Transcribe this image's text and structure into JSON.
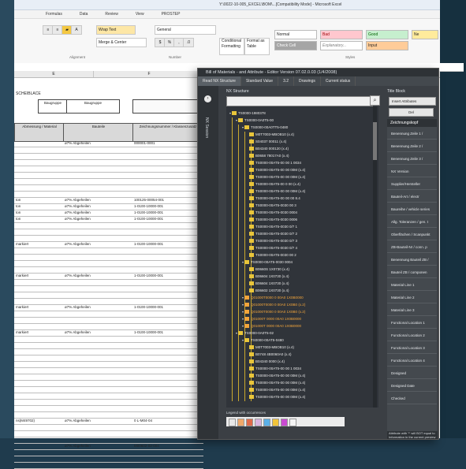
{
  "excel": {
    "title": "Y:\\0022-10-005_EXCEL\\BOM\\...[Compatibility Mode] - Microsoft Excel",
    "menu": [
      "Formulas",
      "Data",
      "Review",
      "View",
      "PROSTEP"
    ],
    "ribbon": {
      "wrap_text": "Wrap Text",
      "number_format": "General",
      "merge_center": "Merge & Center",
      "conditional_formatting": "Conditional Formatting",
      "format_as_table": "Format as Table",
      "styles": [
        "Normal",
        "Bad",
        "Good",
        "Ne",
        "Check Cell",
        "Explanatory...",
        "Input"
      ],
      "groups": [
        "Alignment",
        "Number",
        "Styles"
      ]
    },
    "columns": [
      "E",
      "F"
    ],
    "sheet_header": "SCHEIBLACE",
    "header_boxes": [
      "Baugruppe",
      "Baugruppe"
    ],
    "table_headers": [
      "Abmessung / Material",
      "Bauteile",
      "Zeichnungsnummer / Klassenzusatz"
    ],
    "rows": [
      {
        "a": "",
        "b": "ø7% Abgeheilen",
        "c": "000001-0001"
      },
      {
        "a": "",
        "b": "",
        "c": ""
      },
      {
        "a": "",
        "b": "",
        "c": ""
      },
      {
        "a": "",
        "b": "",
        "c": ""
      },
      {
        "a": "",
        "b": "",
        "c": ""
      },
      {
        "a": "",
        "b": "",
        "c": ""
      },
      {
        "a": "",
        "b": "",
        "c": ""
      },
      {
        "a": "",
        "b": "",
        "c": ""
      },
      {
        "a": "",
        "b": "",
        "c": ""
      },
      {
        "a": "ton",
        "b": "ø7% Abgeheilen",
        "c": "100125-00054-001"
      },
      {
        "a": "ton",
        "b": "ø7% Abgeheilen",
        "c": "1-0100-10000-001"
      },
      {
        "a": "ton",
        "b": "ø7% Abgeheilen",
        "c": "1-0100-10000-001"
      },
      {
        "a": "ton",
        "b": "ø7% Abgeheilen",
        "c": "1-0100-10000-001"
      },
      {
        "a": "",
        "b": "",
        "c": ""
      },
      {
        "a": "",
        "b": "",
        "c": ""
      },
      {
        "a": "",
        "b": "",
        "c": ""
      },
      {
        "a": "markiert",
        "b": "ø7% Abgeheilen",
        "c": "1-0100-10000-001"
      },
      {
        "a": "",
        "b": "",
        "c": ""
      },
      {
        "a": "",
        "b": "",
        "c": ""
      },
      {
        "a": "",
        "b": "",
        "c": ""
      },
      {
        "a": "",
        "b": "",
        "c": ""
      },
      {
        "a": "markiert",
        "b": "ø7% Abgeheilen",
        "c": "1-0100-10000-001"
      },
      {
        "a": "",
        "b": "",
        "c": ""
      },
      {
        "a": "",
        "b": "",
        "c": ""
      },
      {
        "a": "",
        "b": "",
        "c": ""
      },
      {
        "a": "",
        "b": "",
        "c": ""
      },
      {
        "a": "markiert",
        "b": "ø7% Abgeheilen",
        "c": "1-0100-10000-001"
      },
      {
        "a": "",
        "b": "",
        "c": ""
      },
      {
        "a": "",
        "b": "",
        "c": ""
      },
      {
        "a": "",
        "b": "",
        "c": ""
      },
      {
        "a": "markiert",
        "b": "ø7% Abgeheilen",
        "c": "1-0100-10000-001"
      },
      {
        "a": "",
        "b": "",
        "c": ""
      },
      {
        "a": "",
        "b": "",
        "c": ""
      },
      {
        "a": "",
        "b": "",
        "c": ""
      },
      {
        "a": "",
        "b": "",
        "c": ""
      },
      {
        "a": "",
        "b": "",
        "c": ""
      },
      {
        "a": "",
        "b": "",
        "c": ""
      },
      {
        "a": "",
        "b": "",
        "c": ""
      },
      {
        "a": "",
        "b": "",
        "c": ""
      },
      {
        "a": "",
        "b": "",
        "c": ""
      },
      {
        "a": "",
        "b": "",
        "c": ""
      },
      {
        "a": "",
        "b": "",
        "c": ""
      },
      {
        "a": "",
        "b": "",
        "c": ""
      },
      {
        "a": "",
        "b": "",
        "c": ""
      },
      {
        "a": "ns(M49702)",
        "b": "ø7% Abgeheilen",
        "c": "0 L-M04-04"
      },
      {
        "a": "",
        "b": "",
        "c": ""
      },
      {
        "a": "",
        "b": "",
        "c": ""
      },
      {
        "a": "",
        "b": "",
        "c": ""
      },
      {
        "a": "",
        "b": "ø7% Abgeheilen",
        "c": "M00602-02-004"
      },
      {
        "a": "",
        "b": "",
        "c": ""
      },
      {
        "a": "",
        "b": "",
        "c": ""
      },
      {
        "a": "",
        "b": "",
        "c": ""
      }
    ]
  },
  "dialog": {
    "title": "Bill of Materials - and Attribute - Editor Version 07.02.0.03 (1/4/2008)",
    "tabs": [
      "Read NX Structure",
      "Standard Value",
      "3.2",
      "Drawings",
      "Current status"
    ],
    "side_label": "NX Session",
    "tree_label": "NX Structure",
    "search_placeholder": "",
    "tree_nodes": [
      {
        "label": "TS0000-1980378",
        "depth": 0,
        "orange": false
      },
      {
        "label": "TS0000-0A0T5-00",
        "depth": 1,
        "orange": false
      },
      {
        "label": "TS0000-00A0TT5-0480",
        "depth": 2,
        "orange": false
      },
      {
        "label": "M0T7003-MBOB10 (x.4)",
        "depth": 3,
        "orange": false
      },
      {
        "label": "S04037 00011 (x.4)",
        "depth": 3,
        "orange": false
      },
      {
        "label": "B04340 000120 (x.4)",
        "depth": 3,
        "orange": false
      },
      {
        "label": "B0658 78017A0 (x.4)",
        "depth": 3,
        "orange": false
      },
      {
        "label": "TS0000-00AT5-00 00 1 0034",
        "depth": 3,
        "orange": false
      },
      {
        "label": "TS0000-00AT5-00 00 00M (x.4)",
        "depth": 3,
        "orange": false
      },
      {
        "label": "TS0000-00AT5-00 00 00M (x.4)",
        "depth": 3,
        "orange": false
      },
      {
        "label": "TS0000-00AT5-00 0 00 (x.4)",
        "depth": 3,
        "orange": false
      },
      {
        "label": "TS0000-00AT5-00 00 00M (x.4)",
        "depth": 3,
        "orange": false
      },
      {
        "label": "TS0000-00AT5-00 00 00 8.4",
        "depth": 3,
        "orange": false
      },
      {
        "label": "TS0000-00AT5-0030 00 3",
        "depth": 3,
        "orange": false
      },
      {
        "label": "TS0000-00AT5-0030 0004",
        "depth": 3,
        "orange": false
      },
      {
        "label": "TS0000-00AT5-0030 0006",
        "depth": 3,
        "orange": false
      },
      {
        "label": "TS0000-00AT5-0030 0/7 1",
        "depth": 3,
        "orange": false
      },
      {
        "label": "TS0000-00AT5-0030 0/7 2",
        "depth": 3,
        "orange": false
      },
      {
        "label": "TS0000-00AT5-0030 0/7 3",
        "depth": 3,
        "orange": false
      },
      {
        "label": "TS0000-00AT5-0030 0/7 4",
        "depth": 3,
        "orange": false
      },
      {
        "label": "TS0000-00AT5-0030 00 2",
        "depth": 3,
        "orange": false
      },
      {
        "label": "TS0000-00AT5-0030 0004",
        "depth": 2,
        "orange": false
      },
      {
        "label": "B0660S 1X0730 (x.4)",
        "depth": 3,
        "orange": false
      },
      {
        "label": "B06604 1X0730 (x.4)",
        "depth": 3,
        "orange": false
      },
      {
        "label": "B06604 1X0730 (x.4)",
        "depth": 3,
        "orange": false
      },
      {
        "label": "B06602 1X0730 (x.4)",
        "depth": 3,
        "orange": false
      },
      {
        "label": "Q01000T0000 0 00A0 1X0B0000",
        "depth": 2,
        "orange": true
      },
      {
        "label": "Q01000T0000 0 00A0 1X0B0 (x.2)",
        "depth": 2,
        "orange": true
      },
      {
        "label": "Q01000T0000 0 00A0 1X0B0 (x.2)",
        "depth": 2,
        "orange": true
      },
      {
        "label": "Q01000T 0000 00A0 1X0B0000",
        "depth": 2,
        "orange": true
      },
      {
        "label": "Q01000T 0000 00A0 1X0B0000",
        "depth": 2,
        "orange": true
      },
      {
        "label": "TS0000-0A0T5-02",
        "depth": 1,
        "orange": false
      },
      {
        "label": "TS0000-00AT5-0480",
        "depth": 2,
        "orange": false
      },
      {
        "label": "M0T7003-MBOB10 (x.4)",
        "depth": 3,
        "orange": false
      },
      {
        "label": "B0748 4B0060A0 (x.4)",
        "depth": 3,
        "orange": false
      },
      {
        "label": "B04340 0000 (x.4)",
        "depth": 3,
        "orange": false
      },
      {
        "label": "TS0000-00AT5-00 00 1 0034",
        "depth": 3,
        "orange": false
      },
      {
        "label": "TS0000-00AT5-00 00 00M (x.4)",
        "depth": 3,
        "orange": false
      },
      {
        "label": "TS0000-00AT5-00 00 00M (x.4)",
        "depth": 3,
        "orange": false
      },
      {
        "label": "TS0000-00AT5-00 00 00M (x.4)",
        "depth": 3,
        "orange": false
      },
      {
        "label": "TS0000-00AT5-00 00 00M (x.4)",
        "depth": 3,
        "orange": false
      }
    ],
    "legend_label": "Legend with occurrences",
    "legend_colors": [
      "#e8e8e8",
      "#f0a86a",
      "#e06a4a",
      "#d9b4e0",
      "#5bb0e8",
      "#f2c43a",
      "#c94ad1",
      "#f4f4f4"
    ],
    "props": {
      "label": "Title Block",
      "insert_button": "Insert Attributes",
      "second_button": "Del",
      "category": "Zeichnungskopf",
      "items": [
        "Benennung Zeile 1 /",
        "Benennung Zeile 2 /",
        "Benennung Zeile 3 /",
        "NX Version",
        "Supplier/Hersteller",
        "Bauteil-Art / electr",
        "Baureihe / vehicle series",
        "Allg. Toleranzen / gen. t",
        "Oberflächen / Scanpunkt",
        "ZB-Bauteil-Nr / conn. p",
        "Benennung Bauteil ZB /",
        "Bauteil ZB / componen",
        "Material Line 1",
        "Material Line 2",
        "Material Line 3",
        "Functional Location 1",
        "Functional Location 2",
        "Functional Location 3",
        "Functional Location 4",
        "Designed",
        "Designed Date",
        "Checked"
      ],
      "footer": "Attribute with '*' will BOT equal to Information in the current preview"
    }
  }
}
